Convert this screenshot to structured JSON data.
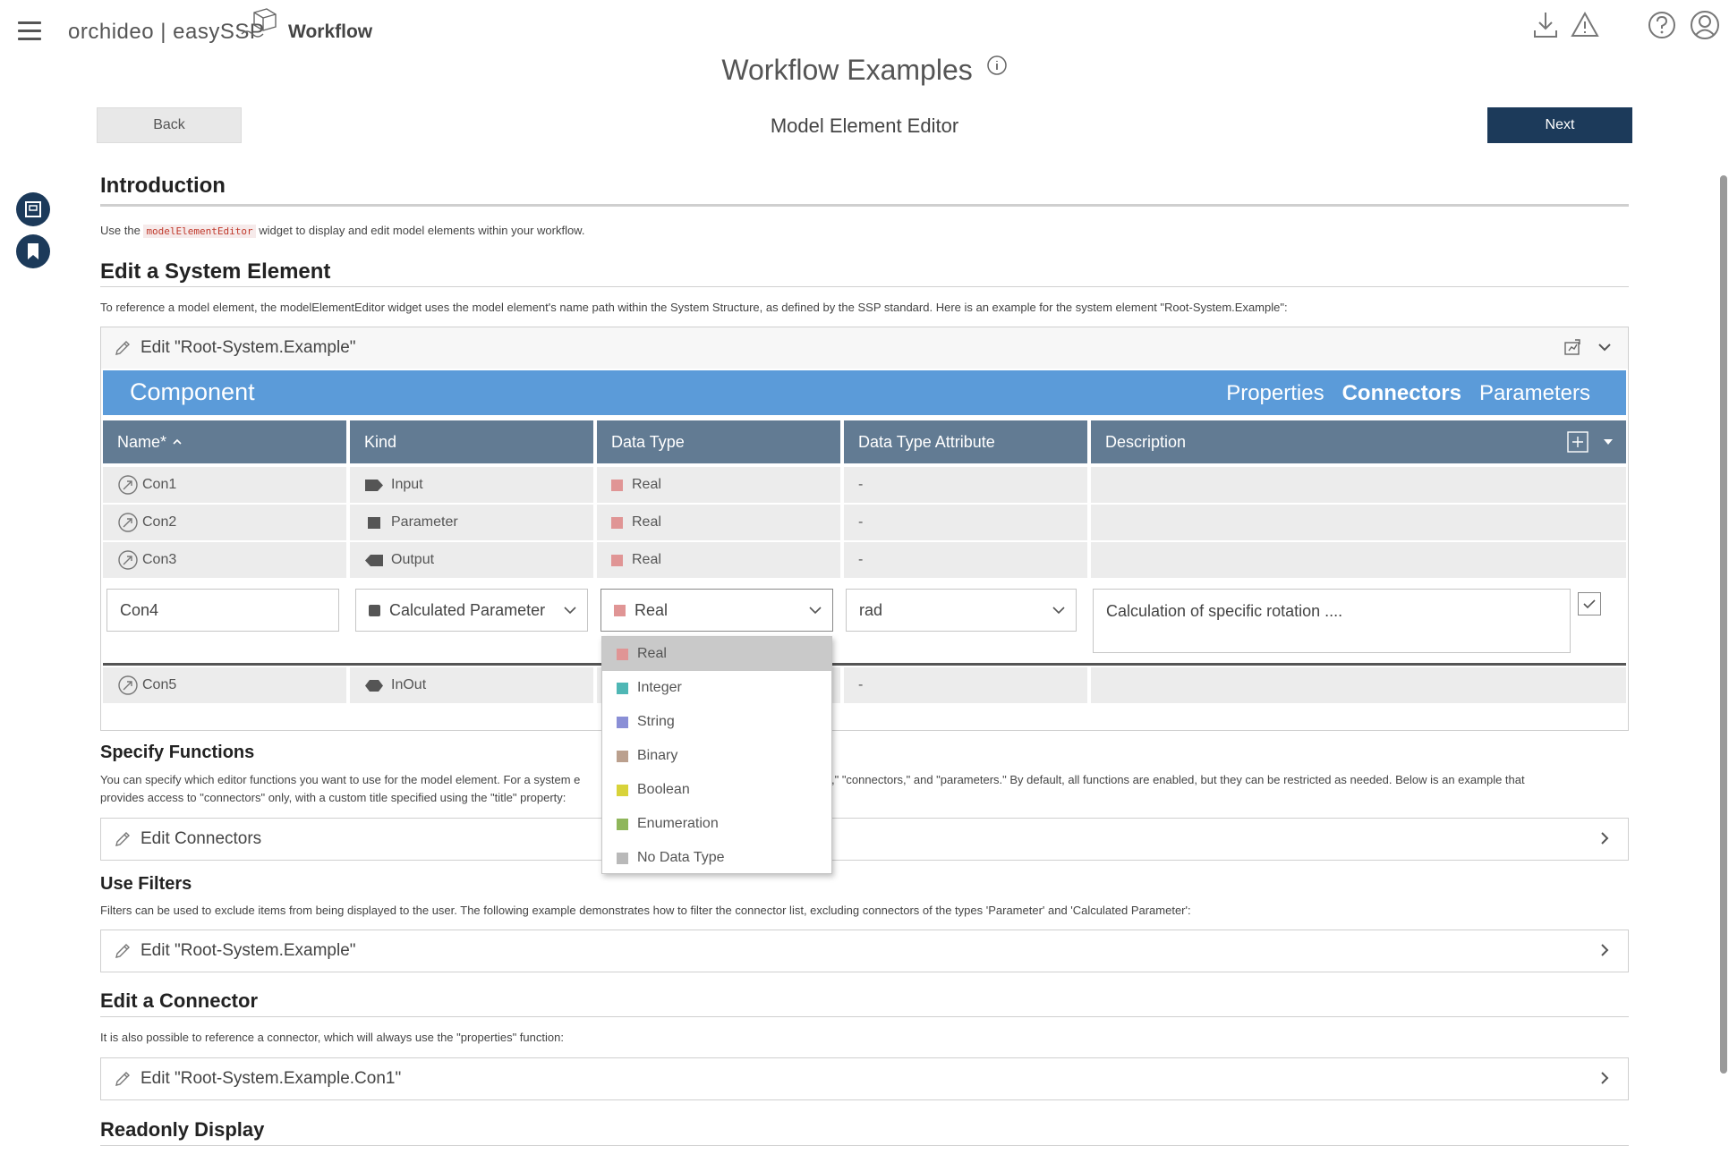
{
  "header": {
    "brand": "orchideo | easySSP",
    "section": "Workflow",
    "page_title": "Workflow Examples",
    "step_title": "Model Element Editor",
    "back_label": "Back",
    "next_label": "Next"
  },
  "intro": {
    "heading": "Introduction",
    "text_before": "Use the",
    "code": "modelElementEditor",
    "text_after": "widget to display and edit model elements within your workflow."
  },
  "system_element": {
    "heading": "Edit a System Element",
    "text": "To reference a model element, the modelElementEditor widget uses the model element's name path within the System Structure, as defined by the SSP standard. Here is an example for the system element \"Root-System.Example\":",
    "editor_title": "Edit \"Root-System.Example\"",
    "component_label": "Component",
    "tabs": [
      "Properties",
      "Connectors",
      "Parameters"
    ],
    "active_tab": "Connectors",
    "columns": [
      "Name*",
      "Kind",
      "Data Type",
      "Data Type Attribute",
      "Description"
    ],
    "rows": [
      {
        "name": "Con1",
        "kind": "Input",
        "data_type": "Real",
        "attr": "-",
        "desc": ""
      },
      {
        "name": "Con2",
        "kind": "Parameter",
        "data_type": "Real",
        "attr": "-",
        "desc": ""
      },
      {
        "name": "Con3",
        "kind": "Output",
        "data_type": "Real",
        "attr": "-",
        "desc": ""
      }
    ],
    "edit_row": {
      "name": "Con4",
      "kind": "Calculated Parameter",
      "data_type": "Real",
      "attr": "rad",
      "desc": "Calculation of specific rotation ...."
    },
    "last_row": {
      "name": "Con5",
      "kind": "InOut",
      "attr": "-"
    },
    "data_type_options": [
      {
        "label": "Real",
        "color": "#e09595"
      },
      {
        "label": "Integer",
        "color": "#4fb7b5"
      },
      {
        "label": "String",
        "color": "#8a8fd6"
      },
      {
        "label": "Binary",
        "color": "#bba08e"
      },
      {
        "label": "Boolean",
        "color": "#d8d33a"
      },
      {
        "label": "Enumeration",
        "color": "#8fb65b"
      },
      {
        "label": "No Data Type",
        "color": "#b9b9b9"
      }
    ]
  },
  "functions": {
    "heading": "Specify Functions",
    "text_line1_a": "You can specify which editor functions you want to use for the model element. For a system e",
    "text_line1_b": "rties,\" \"connectors,\" and \"parameters.\" By default, all functions are enabled, but they can be restricted as needed. Below is an example that",
    "text_line2": "provides access to \"connectors\" only, with a custom title specified using the \"title\" property:",
    "editor_title": "Edit Connectors"
  },
  "filters": {
    "heading": "Use Filters",
    "text": "Filters can be used to exclude items from being displayed to the user. The following example demonstrates how to filter the connector list, excluding connectors of the types 'Parameter' and 'Calculated Parameter':",
    "editor_title": "Edit \"Root-System.Example\""
  },
  "connector": {
    "heading": "Edit a Connector",
    "text": "It is also possible to reference a connector, which will always use the \"properties\" function:",
    "editor_title": "Edit \"Root-System.Example.Con1\""
  },
  "readonly": {
    "heading": "Readonly Display"
  },
  "colors": {
    "accent_dark": "#1c3a5a",
    "band_blue": "#5b9bd9",
    "table_header": "#627b93",
    "real_square": "#e09595",
    "kind_square": "#555555"
  }
}
